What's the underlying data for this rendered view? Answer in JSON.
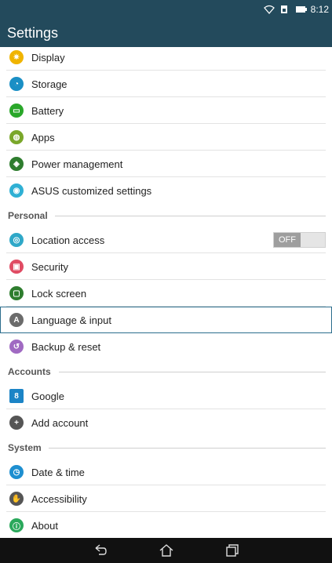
{
  "status": {
    "time": "8:12",
    "icons": [
      "wifi-icon",
      "sim-icon",
      "battery-icon"
    ]
  },
  "app": {
    "title": "Settings"
  },
  "items": [
    {
      "label": "Display",
      "color": "#f0b400",
      "glyph": "✷"
    },
    {
      "label": "Storage",
      "color": "#1a8fc5",
      "glyph": "◔"
    },
    {
      "label": "Battery",
      "color": "#2aa72a",
      "glyph": "▭"
    },
    {
      "label": "Apps",
      "color": "#7aa72a",
      "glyph": "◍"
    },
    {
      "label": "Power management",
      "color": "#2e7d2e",
      "glyph": "◈"
    },
    {
      "label": "ASUS customized settings",
      "color": "#2fb0d4",
      "glyph": "◉"
    }
  ],
  "sections": {
    "personal": "Personal",
    "accounts": "Accounts",
    "system": "System"
  },
  "personal_items": [
    {
      "label": "Location access",
      "color": "#2fa8c8",
      "glyph": "◎"
    },
    {
      "label": "Security",
      "color": "#e04b63",
      "glyph": "🔒"
    },
    {
      "label": "Lock screen",
      "color": "#2e7d2e",
      "glyph": "▢"
    },
    {
      "label": "Language & input",
      "color": "#6b6b6b",
      "glyph": "A"
    },
    {
      "label": "Backup & reset",
      "color": "#a06ac2",
      "glyph": "↺"
    }
  ],
  "accounts_items": [
    {
      "label": "Google",
      "color": "#1b84c6",
      "glyph": "8"
    },
    {
      "label": "Add account",
      "color": "#555555",
      "glyph": "+"
    }
  ],
  "system_items": [
    {
      "label": "Date & time",
      "color": "#1e8fd0",
      "glyph": "◷"
    },
    {
      "label": "Accessibility",
      "color": "#555555",
      "glyph": "✋"
    },
    {
      "label": "About",
      "color": "#2aa85b",
      "glyph": "ⓘ"
    }
  ],
  "location_toggle": {
    "label": "OFF",
    "state": "off"
  }
}
